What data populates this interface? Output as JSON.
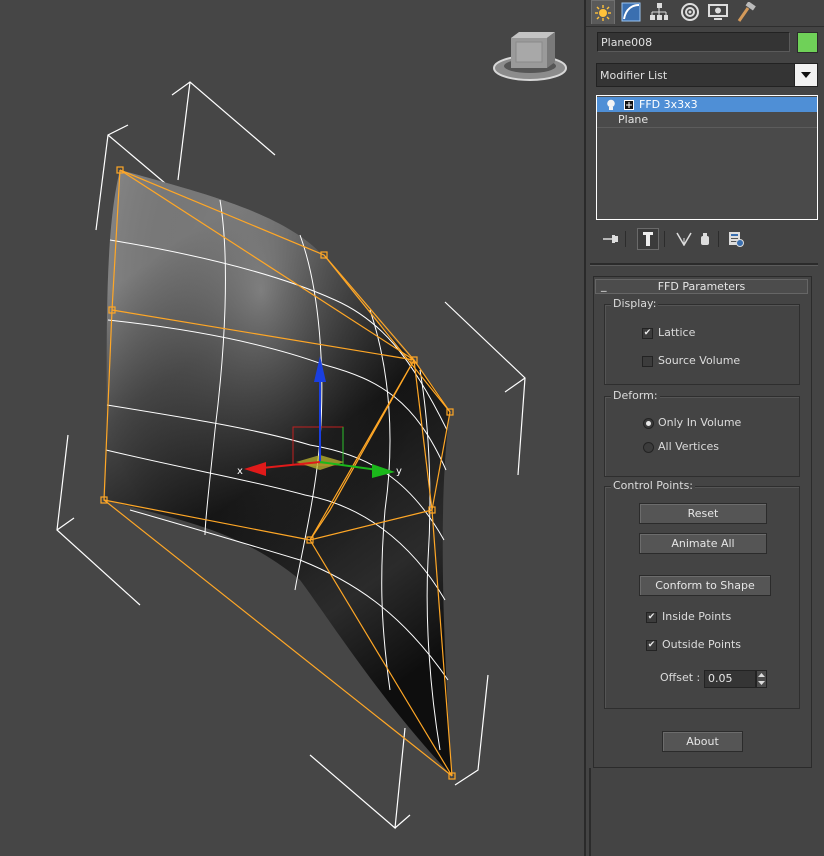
{
  "panel": {
    "tabs": [
      {
        "name": "create-tab",
        "icon": "sun-icon"
      },
      {
        "name": "modify-tab",
        "icon": "modify-curve-icon"
      },
      {
        "name": "hierarchy-tab",
        "icon": "hierarchy-icon"
      },
      {
        "name": "motion-tab",
        "icon": "motion-icon"
      },
      {
        "name": "display-tab",
        "icon": "display-monitor-icon"
      },
      {
        "name": "utilities-tab",
        "icon": "hammer-icon"
      }
    ],
    "object_name": "Plane008",
    "object_color": "#6fd158",
    "modifier_list_label": "Modifier List",
    "stack": {
      "modifier": "FFD 3x3x3",
      "base": "Plane"
    },
    "stack_toolbar": [
      "pin-stack-icon",
      "show-end-result-icon",
      "make-unique-icon",
      "remove-modifier-icon",
      "configure-modifier-sets-icon"
    ]
  },
  "ffd_parameters": {
    "rollout_title": "FFD Parameters",
    "display": {
      "title": "Display:",
      "lattice": {
        "label": "Lattice",
        "checked": true
      },
      "source_volume": {
        "label": "Source Volume",
        "checked": false
      }
    },
    "deform": {
      "title": "Deform:",
      "only_in_volume": {
        "label": "Only In Volume",
        "selected": true
      },
      "all_vertices": {
        "label": "All Vertices",
        "selected": false
      }
    },
    "control_points": {
      "title": "Control Points:",
      "reset_label": "Reset",
      "animate_all_label": "Animate All",
      "conform_label": "Conform to Shape",
      "inside_points": {
        "label": "Inside Points",
        "checked": true
      },
      "outside_points": {
        "label": "Outside Points",
        "checked": true
      },
      "offset_label": "Offset :",
      "offset_value": "0.05"
    },
    "about_label": "About"
  },
  "viewport": {
    "gizmo_labels": {
      "x": "x",
      "y": "y"
    },
    "colors": {
      "lattice": "#ffa726",
      "wire": "#ffffff",
      "axis_x": "#e01a1a",
      "axis_y": "#1bb81b",
      "axis_z": "#1a3fe0",
      "selection": "#4f8fd6"
    }
  }
}
